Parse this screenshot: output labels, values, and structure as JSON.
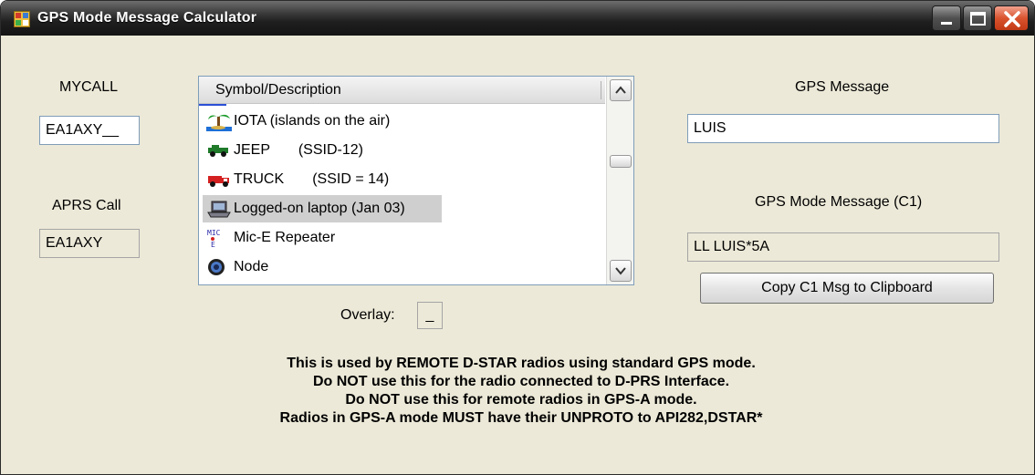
{
  "window": {
    "title": "GPS Mode Message Calculator"
  },
  "fields": {
    "mycall_label": "MYCALL",
    "mycall_value": "EA1AXY__",
    "aprs_call_label": "APRS Call",
    "aprs_call_value": "EA1AXY",
    "gps_message_label": "GPS Message",
    "gps_message_value": "LUIS",
    "gps_mode_message_label": "GPS Mode Message (C1)",
    "gps_mode_message_value": "LL  LUIS*5A",
    "overlay_label": "Overlay:",
    "overlay_value": "_"
  },
  "symbol_list": {
    "header": "Symbol/Description",
    "items": [
      {
        "icon": "palm-tree-icon",
        "label": "IOTA (islands on the air)",
        "selected": false
      },
      {
        "icon": "jeep-icon",
        "label": "JEEP       (SSID-12)",
        "selected": false
      },
      {
        "icon": "truck-icon",
        "label": "TRUCK       (SSID = 14)",
        "selected": false
      },
      {
        "icon": "laptop-icon",
        "label": "Logged-on laptop (Jan 03)",
        "selected": true
      },
      {
        "icon": "mic-e-icon",
        "label": "Mic-E Repeater",
        "selected": false
      },
      {
        "icon": "node-icon",
        "label": "Node",
        "selected": false
      }
    ]
  },
  "buttons": {
    "copy_label": "Copy C1 Msg to Clipboard"
  },
  "notes": {
    "line1": "This is used by REMOTE D-STAR radios using standard GPS mode.",
    "line2": "Do NOT use this for the radio connected to D-PRS Interface.",
    "line3": "Do NOT use this for remote radios in GPS-A mode.",
    "line4": "Radios in GPS-A mode MUST have their UNPROTO to API282,DSTAR*"
  },
  "colors": {
    "window_bg": "#ece9d8",
    "titlebar": "#1f1f1f",
    "close_button": "#d9532e",
    "selection": "#cfcfcf"
  }
}
